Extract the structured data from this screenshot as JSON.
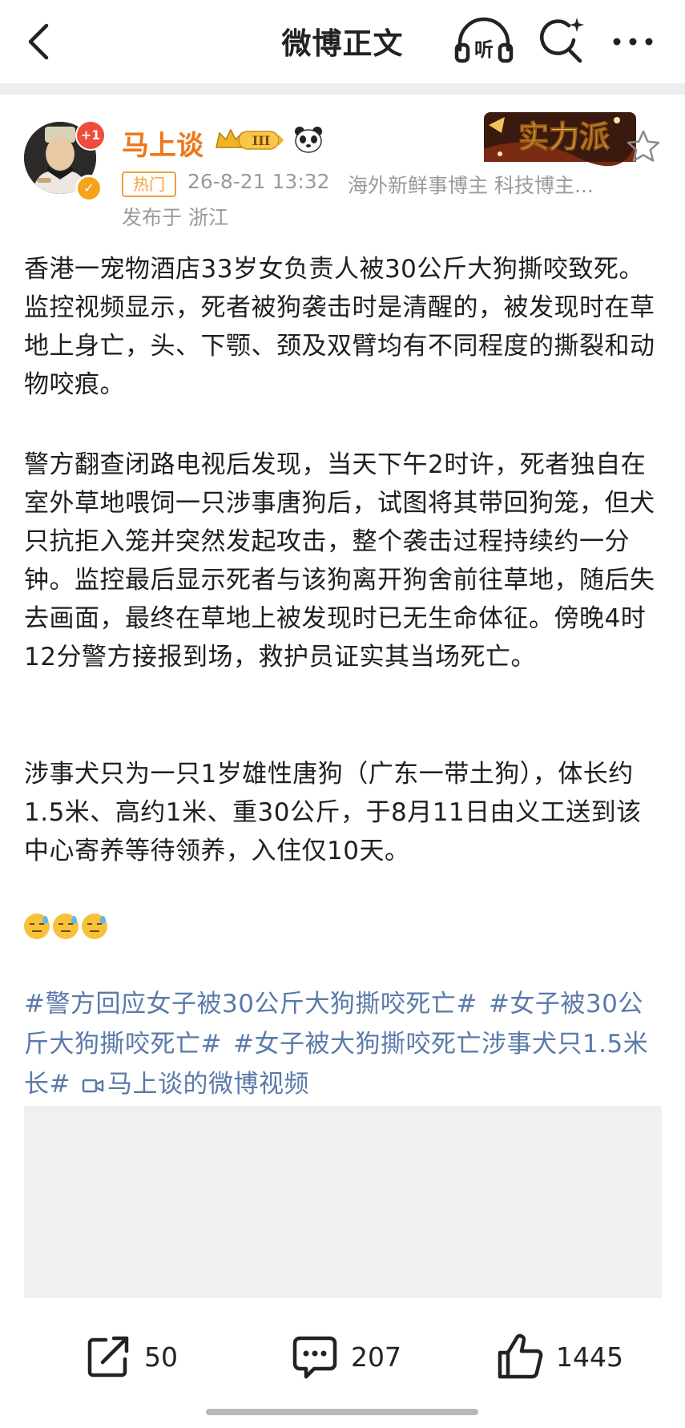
{
  "nav": {
    "title": "微博正文",
    "listen_label": "听"
  },
  "author": {
    "name": "马上谈",
    "avatar_plus": "+1",
    "level": "III",
    "hot_tag": "热门",
    "time": "26-8-21 13:32",
    "tags": "海外新鲜事博主 科技博主...",
    "location": "发布于 浙江",
    "badge_text": "实力派"
  },
  "post": {
    "paragraph1": "香港一宠物酒店33岁女负责人被30公斤大狗撕咬致死。监控视频显示，死者被狗袭击时是清醒的，被发现时在草地上身亡，头、下颚、颈及双臂均有不同程度的撕裂和动物咬痕。",
    "paragraph2": "警方翻查闭路电视后发现，当天下午2时许，死者独自在室外草地喂饲一只涉事唐狗后，试图将其带回狗笼，但犬只抗拒入笼并突然发起攻击，整个袭击过程持续约一分钟。监控最后显示死者与该狗离开狗舍前往草地，随后失去画面，最终在草地上被发现时已无生命体征。傍晚4时12分警方接报到场，救护员证实其当场死亡。",
    "paragraph3": "涉事犬只为一只1岁雄性唐狗（广东一带土狗），体长约1.5米、高约1米、重30公斤，于8月11日由义工送到该中心寄养等待领养，入住仅10天。",
    "hashtag1": "#警方回应女子被30公斤大狗撕咬死亡#",
    "hashtag2": "#女子被30公斤大狗撕咬死亡#",
    "hashtag3": "#女子被大狗撕咬死亡涉事犬只1.5米长#",
    "video_link": "马上谈的微博视频"
  },
  "actions": {
    "share_count": "50",
    "comment_count": "207",
    "like_count": "1445"
  },
  "colors": {
    "accent_orange": "#f0761a",
    "link_blue": "#5a7aaa",
    "meta_gray": "#9a9a9a"
  }
}
